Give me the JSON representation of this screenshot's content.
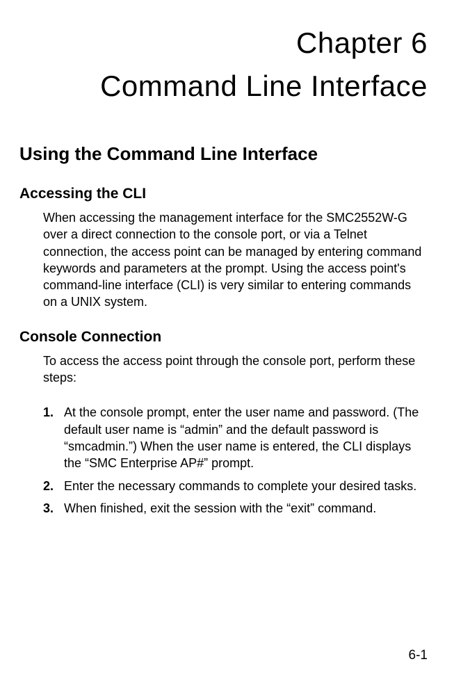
{
  "chapter": {
    "number_label": "Chapter 6",
    "title": "Command Line Interface"
  },
  "section": {
    "heading": "Using the Command Line Interface"
  },
  "subsection1": {
    "heading": "Accessing the CLI",
    "body": "When accessing the management interface for the SMC2552W-G over a direct connection to the console port, or via a Telnet connection, the access point can be managed by entering command keywords and parameters at the prompt. Using the access point's command-line interface (CLI) is very similar to entering commands on a UNIX system."
  },
  "subsection2": {
    "heading": "Console Connection",
    "intro": "To access the access point through the console port, perform these steps:",
    "steps": [
      {
        "marker": "1.",
        "text": "At the console prompt, enter the user name and password. (The default user name is “admin” and the default password is “smcadmin.”) When the user name is entered, the CLI displays the “SMC Enterprise AP#” prompt."
      },
      {
        "marker": "2.",
        "text": "Enter the necessary commands to complete your desired tasks."
      },
      {
        "marker": "3.",
        "text": "When finished, exit the session with the “exit” command."
      }
    ]
  },
  "footer": {
    "page_prefix": "6-",
    "page_number": "1"
  }
}
